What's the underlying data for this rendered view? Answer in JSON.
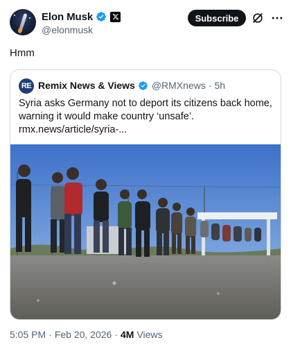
{
  "author": {
    "display_name": "Elon Musk",
    "handle": "@elonmusk",
    "avatar_icon": "rocket-avatar-icon",
    "verified_icon": "verified-badge-icon",
    "affiliation_icon": "x-logo-icon"
  },
  "actions": {
    "subscribe_label": "Subscribe",
    "grok_icon": "grok-icon",
    "more_icon": "more-options-icon"
  },
  "post_text": "Hmm",
  "quote": {
    "avatar_text": "RE",
    "display_name": "Remix News & Views",
    "handle": "@RMXnews",
    "separator": "·",
    "time_ago": "5h",
    "body": "Syria asks Germany not to deport its citizens back home, warning it would make country ‘unsafe’.",
    "link": "rmx.news/article/syria-...",
    "image_description_icon": "news-photo"
  },
  "meta": {
    "time": "5:05 PM",
    "separator": "·",
    "date": "Feb 20, 2026",
    "views_count": "4M",
    "views_label": "Views"
  },
  "colors": {
    "accent": "#1d9bf0",
    "text_primary": "#0f1419",
    "text_secondary": "#536471",
    "border": "#cfd9de"
  }
}
